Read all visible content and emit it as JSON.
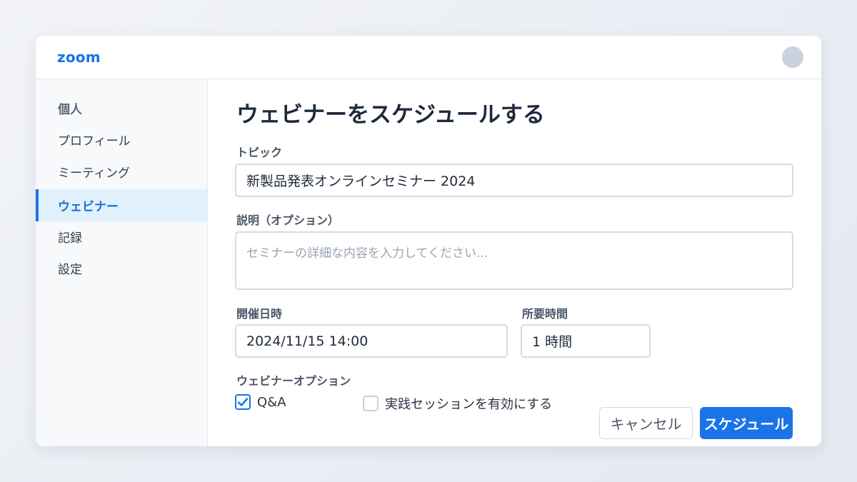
{
  "app": {
    "logo": "zoom"
  },
  "sidebar": {
    "heading": "個人",
    "items": [
      {
        "label": "プロフィール",
        "active": false
      },
      {
        "label": "ミーティング",
        "active": false
      },
      {
        "label": "ウェビナー",
        "active": true
      },
      {
        "label": "記録",
        "active": false
      },
      {
        "label": "設定",
        "active": false
      }
    ]
  },
  "form": {
    "title": "ウェビナーをスケジュールする",
    "topic": {
      "label": "トピック",
      "value": "新製品発表オンラインセミナー 2024"
    },
    "description": {
      "label": "説明（オプション）",
      "placeholder": "セミナーの詳細な内容を入力してください..."
    },
    "datetime": {
      "label": "開催日時",
      "value": "2024/11/15 14:00"
    },
    "duration": {
      "label": "所要時間",
      "value": "1 時間"
    },
    "options": {
      "label": "ウェビナーオプション",
      "qa": {
        "label": "Q&A",
        "checked": true
      },
      "practice": {
        "label": "実践セッションを有効にする",
        "checked": false
      }
    },
    "buttons": {
      "cancel": "キャンセル",
      "schedule": "スケジュール"
    }
  },
  "colors": {
    "accent": "#1a73e8",
    "active_bg": "#e2f0fc"
  }
}
